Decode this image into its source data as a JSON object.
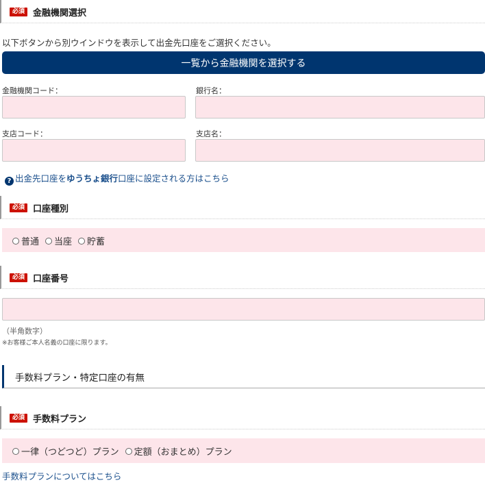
{
  "section_bank": {
    "required_badge": "必須",
    "title": "金融機関選択",
    "description": "以下ボタンから別ウインドウを表示して出金先口座をご選択ください。",
    "select_button": "一覧から金融機関を選択する",
    "fields": {
      "bank_code_label": "金融機関コード：",
      "bank_name_label": "銀行名：",
      "branch_code_label": "支店コード：",
      "branch_name_label": "支店名："
    },
    "yucho_link": {
      "part1": "出金先口座を",
      "bold": "ゆうちょ銀行",
      "part2": "口座に設定される方はこちら"
    }
  },
  "section_account_type": {
    "required_badge": "必須",
    "title": "口座種別",
    "options": [
      "普通",
      "当座",
      "貯蓄"
    ]
  },
  "section_account_number": {
    "required_badge": "必須",
    "title": "口座番号",
    "note_halfwidth": "（半角数字）",
    "note_owner": "※お客様ご本人名義の口座に限ります。"
  },
  "heading_fee": {
    "title": "手数料プラン・特定口座の有無"
  },
  "section_fee_plan": {
    "required_badge": "必須",
    "title": "手数料プラン",
    "options": [
      "一律（つどつど）プラン",
      "定額（おまとめ）プラン"
    ],
    "link": "手数料プランについてはこちら"
  },
  "colors": {
    "navy": "#00356f",
    "required_red": "#cc1100",
    "input_pink": "#fde5ea",
    "link": "#1a4f8c"
  }
}
